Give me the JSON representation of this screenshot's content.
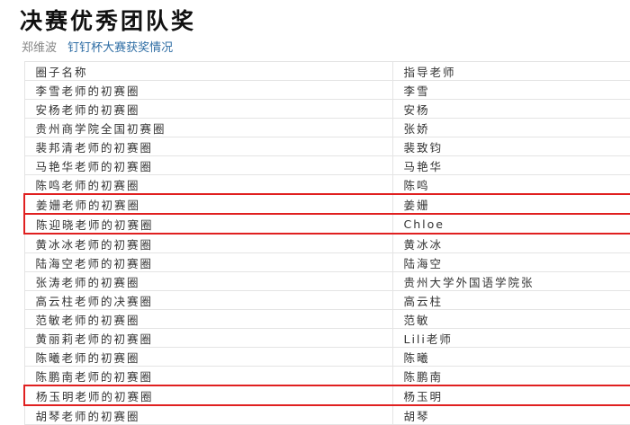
{
  "page": {
    "title": "决赛优秀团队奖",
    "author": "郑维波",
    "topic": "钉钉杯大赛获奖情况"
  },
  "table": {
    "headers": [
      "圈子名称",
      "指导老师"
    ],
    "rows": [
      {
        "circle": "李雪老师的初赛圈",
        "teacher": "李雪",
        "highlighted": false
      },
      {
        "circle": "安杨老师的初赛圈",
        "teacher": "安杨",
        "highlighted": false
      },
      {
        "circle": "贵州商学院全国初赛圈",
        "teacher": "张娇",
        "highlighted": false
      },
      {
        "circle": "裴邦清老师的初赛圈",
        "teacher": "裴致钧",
        "highlighted": false
      },
      {
        "circle": "马艳华老师的初赛圈",
        "teacher": "马艳华",
        "highlighted": false
      },
      {
        "circle": "陈鸣老师的初赛圈",
        "teacher": "陈鸣",
        "highlighted": false
      },
      {
        "circle": "姜姗老师的初赛圈",
        "teacher": "姜姗",
        "highlighted": true
      },
      {
        "circle": "陈迎晓老师的初赛圈",
        "teacher": "Chloe",
        "highlighted": true
      },
      {
        "circle": "黄冰冰老师的初赛圈",
        "teacher": "黄冰冰",
        "highlighted": false
      },
      {
        "circle": "陆海空老师的初赛圈",
        "teacher": "陆海空",
        "highlighted": false
      },
      {
        "circle": "张涛老师的初赛圈",
        "teacher": "贵州大学外国语学院张",
        "highlighted": false
      },
      {
        "circle": "高云柱老师的决赛圈",
        "teacher": "高云柱",
        "highlighted": false
      },
      {
        "circle": "范敏老师的初赛圈",
        "teacher": "范敏",
        "highlighted": false
      },
      {
        "circle": "黄丽莉老师的初赛圈",
        "teacher": "Lili老师",
        "highlighted": false
      },
      {
        "circle": "陈曦老师的初赛圈",
        "teacher": "陈曦",
        "highlighted": false
      },
      {
        "circle": "陈鹏南老师的初赛圈",
        "teacher": "陈鹏南",
        "highlighted": false
      },
      {
        "circle": "杨玉明老师的初赛圈",
        "teacher": "杨玉明",
        "highlighted": true
      },
      {
        "circle": "胡琴老师的初赛圈",
        "teacher": "胡琴",
        "highlighted": false
      }
    ]
  }
}
